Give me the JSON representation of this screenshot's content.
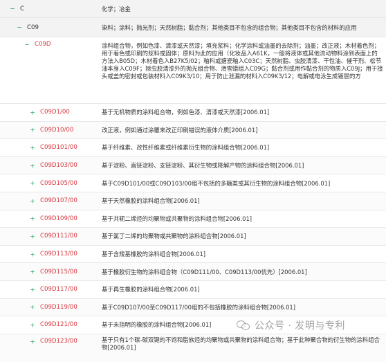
{
  "root": {
    "code": "C",
    "desc": "化学；冶金",
    "toggle": "−"
  },
  "level1": {
    "code": "C09",
    "desc": "染料；涂料；抛光剂；天然树脂；黏合剂；其他类目不包含的组合物；其他类目不包含的材料的应用",
    "toggle": "−"
  },
  "level2": {
    "code": "C09D",
    "desc": "涂料组合物，例如色漆、清漆或天然漆；填充浆料；化学涂料或油墨的去除剂；油墨；改正液；木材着色剂；用于着色或印刷的浆料或固体；原料为此的应用（化妆品入A61K，一般将液体或其他流动物料涂到表面上的方法入B05D；木材着色入B27K5/02；釉料或搪瓷釉入C03C；天然树脂、虫胶清漆、干性油、催干剂、松节油本身入C09F；除虫胶清漆外的抛光组合物、滑雪蜡组入C09G；黏合剂或用作黏合剂的物质入C09J；用于接头或盖的密封或包装材料入C09K3/10；用于防止泄漏的材料入C09K3/12；电解或电泳生成镀层的方",
    "toggle": "−"
  },
  "children": [
    {
      "code": "C09D1/00",
      "desc": "基于无机物质的涂料组合物，例如色漆、清漆或天然漆[2006.01]",
      "toggle": "+"
    },
    {
      "code": "C09D10/00",
      "desc": "改正液，例如通过涂覆来改正印刷错误的液体介质[2006.01]",
      "toggle": "+"
    },
    {
      "code": "C09D101/00",
      "desc": "基于纤维素、改性纤维素或纤维素衍生物的涂料组合物[2006.01]",
      "toggle": "+"
    },
    {
      "code": "C09D103/00",
      "desc": "基于淀粉、直链淀粉、支链淀粉、其衍生物或降解产物的涂料组合物[2006.01]",
      "toggle": "+"
    },
    {
      "code": "C09D105/00",
      "desc": "基于C09D101/00或C09D103/00组不包括的多糖类或其衍生物的涂料组合物[2006.01]",
      "toggle": "+"
    },
    {
      "code": "C09D107/00",
      "desc": "基于天然橡胶的涂料组合物[2006.01]",
      "toggle": "+"
    },
    {
      "code": "C09D109/00",
      "desc": "基于共轭二烯烃的均聚物或共聚物的涂料组合物[2006.01]",
      "toggle": "+"
    },
    {
      "code": "C09D111/00",
      "desc": "基于氯丁二烯的均聚物或共聚物的涂料组合物[2006.01]",
      "toggle": "+"
    },
    {
      "code": "C09D113/00",
      "desc": "基于含羧基橡胶的涂料组合物[2006.01]",
      "toggle": "+"
    },
    {
      "code": "C09D115/00",
      "desc": "基于橡胶衍生物的涂料组合物（C09D111/00、C09D113/00优先）[2006.01]",
      "toggle": "+"
    },
    {
      "code": "C09D117/00",
      "desc": "基于再生橡胶的涂料组合物[2006.01]",
      "toggle": "+"
    },
    {
      "code": "C09D119/00",
      "desc": "基于C09D107/00至C09D117/00组的不包括橡胶的涂料组合物[2006.01]",
      "toggle": "+"
    },
    {
      "code": "C09D121/00",
      "desc": "基于未指明的橡胶的涂料组合物[2006.01]",
      "toggle": "+"
    },
    {
      "code": "C09D123/00",
      "desc": "基于只有1个碳-碳双键的不饱和脂族烃的均聚物或共聚物的涂料组合物；基于此种聚合物的衍生物的涂料组合物[2006.01]",
      "toggle": "+"
    }
  ],
  "watermark": {
    "text": "公众号 · 发明与专利",
    "icon": "wechat-icon"
  },
  "colors": {
    "code_red": "#d9373f",
    "toggle_green": "#4caf7d",
    "row_gray": "#f3f3f3"
  }
}
